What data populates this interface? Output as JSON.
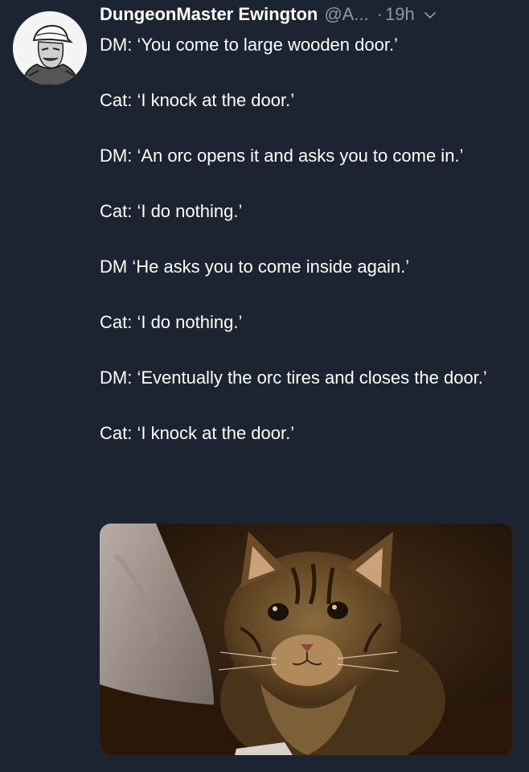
{
  "tweet": {
    "display_name": "DungeonMaster Ewington",
    "handle": "@A...",
    "separator": "·",
    "time": "19h",
    "paragraphs": [
      "DM: ‘You come to large wooden door.’",
      "Cat: ‘I knock at the door.’",
      "DM: ‘An orc opens it and asks you to come in.’",
      "Cat: ‘I do nothing.’",
      "DM ‘He asks you to come inside again.’",
      "Cat: ‘I do nothing.’",
      "DM: ‘Eventually the orc tires and closes the door.’",
      "Cat: ‘I knock at the door.’"
    ],
    "icons": {
      "avatar": "user-avatar-drawing",
      "menu": "chevron-down-icon"
    },
    "media": {
      "subject": "photo-of-tabby-cat"
    }
  },
  "colors": {
    "background": "#1c2331",
    "text": "#ffffff",
    "muted": "#8899a6"
  }
}
